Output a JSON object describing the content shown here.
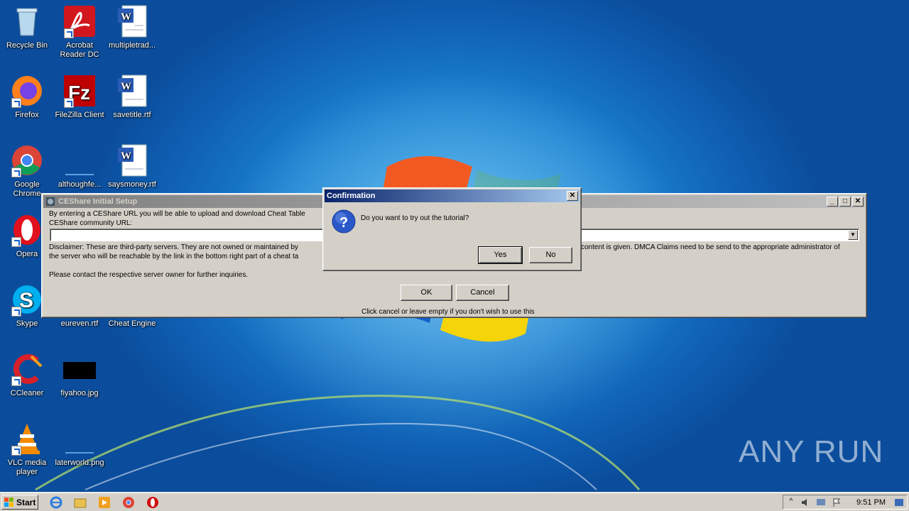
{
  "desktop": {
    "icons": [
      {
        "label": "Recycle Bin",
        "icon": "recycle-bin-icon"
      },
      {
        "label": "Acrobat Reader DC",
        "icon": "acrobat-icon"
      },
      {
        "label": "multipletrad...",
        "icon": "word-document-icon"
      },
      {
        "label": "Firefox",
        "icon": "firefox-icon"
      },
      {
        "label": "FileZilla Client",
        "icon": "filezilla-icon"
      },
      {
        "label": "savetitle.rtf",
        "icon": "word-document-icon"
      },
      {
        "label": "Google Chrome",
        "icon": "chrome-icon"
      },
      {
        "label": "althoughfe...",
        "icon": "blank-file-icon"
      },
      {
        "label": "saysmoney.rtf",
        "icon": "word-document-icon"
      },
      {
        "label": "Opera",
        "icon": "opera-icon"
      },
      {
        "label": "Skype",
        "icon": "skype-icon"
      },
      {
        "label": "eureven.rtf",
        "icon": "word-document-icon"
      },
      {
        "label": "Cheat Engine",
        "icon": "cheat-engine-icon"
      },
      {
        "label": "CCleaner",
        "icon": "ccleaner-icon"
      },
      {
        "label": "fiyahoo.jpg",
        "icon": "image-file-icon"
      },
      {
        "label": "VLC media player",
        "icon": "vlc-icon"
      },
      {
        "label": "laterworld.png",
        "icon": "image-file-icon"
      }
    ]
  },
  "setup_window": {
    "title": "CEShare Initial Setup",
    "intro": "By entering a CEShare URL you will be able to upload and download Cheat Table",
    "url_label": "CEShare community URL:",
    "url_value": "",
    "disclaimer_left": "Disclaimer: These are third-party servers. They are not owned or maintained by",
    "disclaimer_right": "content is given.  DMCA Claims need to be send to the appropriate administrator of",
    "disclaimer_line2": "the server who will be reachable by the link in the bottom right part of a cheat ta",
    "contact": "Please contact the respective server owner for further inquiries.",
    "ok_label": "OK",
    "cancel_label": "Cancel",
    "footer": "Click cancel or leave empty if you don't wish to use this"
  },
  "confirm_dialog": {
    "title": "Confirmation",
    "message": "Do you want to try out the tutorial?",
    "yes_label": "Yes",
    "no_label": "No"
  },
  "taskbar": {
    "start_label": "Start",
    "clock": "9:51 PM"
  },
  "watermark": "ANY RUN"
}
